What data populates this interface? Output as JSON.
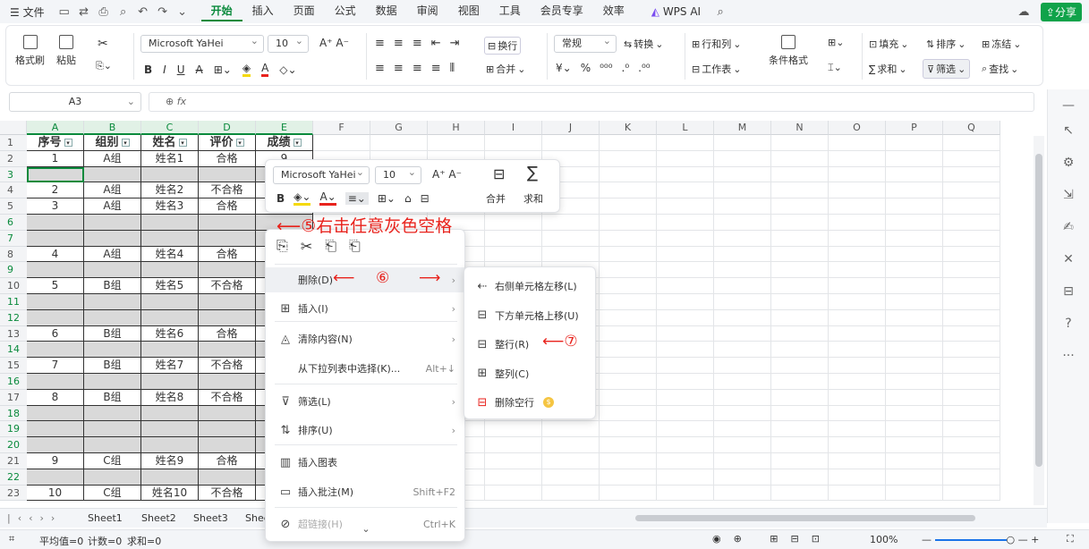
{
  "menubar": {
    "file": "文件",
    "items": [
      "开始",
      "插入",
      "页面",
      "公式",
      "数据",
      "审阅",
      "视图",
      "工具",
      "会员专享",
      "效率"
    ],
    "active": "开始",
    "wpsai": "WPS AI",
    "share": "分享"
  },
  "ribbon": {
    "format_painter": "格式刷",
    "paste": "粘贴",
    "font": "Microsoft YaHei",
    "size": "10",
    "wrap": "换行",
    "number_format": "常规",
    "convert": "转换",
    "rowcol": "行和列",
    "merge": "合并",
    "worksheet": "工作表",
    "cond_format": "条件格式",
    "fill": "填充",
    "sort": "排序",
    "freeze": "冻结",
    "sum": "求和",
    "filter": "筛选",
    "find": "查找"
  },
  "formula_bar": {
    "namebox": "A3",
    "fx": "fx"
  },
  "columns": [
    "A",
    "B",
    "C",
    "D",
    "E",
    "F",
    "G",
    "H",
    "I",
    "J",
    "K",
    "L",
    "M",
    "N",
    "O",
    "P",
    "Q"
  ],
  "rows": [
    "1",
    "2",
    "3",
    "4",
    "5",
    "6",
    "7",
    "8",
    "9",
    "10",
    "11",
    "12",
    "13",
    "14",
    "15",
    "16",
    "17",
    "18",
    "19",
    "20",
    "21",
    "22",
    "23"
  ],
  "table": {
    "header": [
      "序号",
      "组别",
      "姓名",
      "评价",
      "成绩"
    ],
    "data": [
      [
        "1",
        "A组",
        "姓名1",
        "合格",
        "9"
      ],
      [
        "",
        "",
        "",
        "",
        ""
      ],
      [
        "2",
        "A组",
        "姓名2",
        "不合格",
        ""
      ],
      [
        "3",
        "A组",
        "姓名3",
        "合格",
        ""
      ],
      [
        "",
        "",
        "",
        "",
        ""
      ],
      [
        "",
        "",
        "",
        "",
        ""
      ],
      [
        "4",
        "A组",
        "姓名4",
        "合格",
        ""
      ],
      [
        "",
        "",
        "",
        "",
        ""
      ],
      [
        "5",
        "B组",
        "姓名5",
        "不合格",
        ""
      ],
      [
        "",
        "",
        "",
        "",
        ""
      ],
      [
        "",
        "",
        "",
        "",
        ""
      ],
      [
        "6",
        "B组",
        "姓名6",
        "合格",
        ""
      ],
      [
        "",
        "",
        "",
        "",
        ""
      ],
      [
        "7",
        "B组",
        "姓名7",
        "不合格",
        ""
      ],
      [
        "",
        "",
        "",
        "",
        ""
      ],
      [
        "8",
        "B组",
        "姓名8",
        "不合格",
        ""
      ],
      [
        "",
        "",
        "",
        "",
        ""
      ],
      [
        "",
        "",
        "",
        "",
        ""
      ],
      [
        "",
        "",
        "",
        "",
        ""
      ],
      [
        "9",
        "C组",
        "姓名9",
        "合格",
        ""
      ],
      [
        "",
        "",
        "",
        "",
        ""
      ],
      [
        "10",
        "C组",
        "姓名10",
        "不合格",
        ""
      ]
    ]
  },
  "sheets": [
    "Sheet1",
    "Sheet2",
    "Sheet3",
    "Shee"
  ],
  "status": {
    "avg": "平均值=0",
    "count": "计数=0",
    "sum": "求和=0",
    "zoom": "100%"
  },
  "mini_toolbar": {
    "font": "Microsoft YaHei",
    "size": "10",
    "merge": "合并",
    "sum": "求和"
  },
  "context_menu": {
    "items": [
      {
        "icon": "delete-icon",
        "label": "删除(D)",
        "shortcut": "",
        "arrow": "›"
      },
      {
        "icon": "insert-icon",
        "label": "插入(I)",
        "shortcut": "",
        "arrow": "›"
      },
      {
        "icon": "clear-icon",
        "label": "清除内容(N)",
        "shortcut": "",
        "arrow": "›"
      },
      {
        "icon": "",
        "label": "从下拉列表中选择(K)...",
        "shortcut": "Alt+↓",
        "arrow": ""
      },
      {
        "icon": "filter-icon",
        "label": "筛选(L)",
        "shortcut": "",
        "arrow": "›"
      },
      {
        "icon": "sort-icon",
        "label": "排序(U)",
        "shortcut": "",
        "arrow": "›"
      },
      {
        "icon": "chart-icon",
        "label": "插入图表",
        "shortcut": "",
        "arrow": ""
      },
      {
        "icon": "comment-icon",
        "label": "插入批注(M)",
        "shortcut": "Shift+F2",
        "arrow": ""
      },
      {
        "icon": "link-icon",
        "label": "超链接(H)",
        "shortcut": "Ctrl+K",
        "arrow": ""
      }
    ]
  },
  "submenu": {
    "items": [
      "右侧单元格左移(L)",
      "下方单元格上移(U)",
      "整行(R)",
      "整列(C)",
      "删除空行"
    ]
  },
  "annotations": {
    "step5": "⑤右击任意灰色空格",
    "step6": "⑥",
    "step7": "⑦"
  },
  "colors": {
    "accent": "#0a8a3c",
    "annotation": "#e8221c",
    "gray_cell": "#d9d9d9"
  }
}
